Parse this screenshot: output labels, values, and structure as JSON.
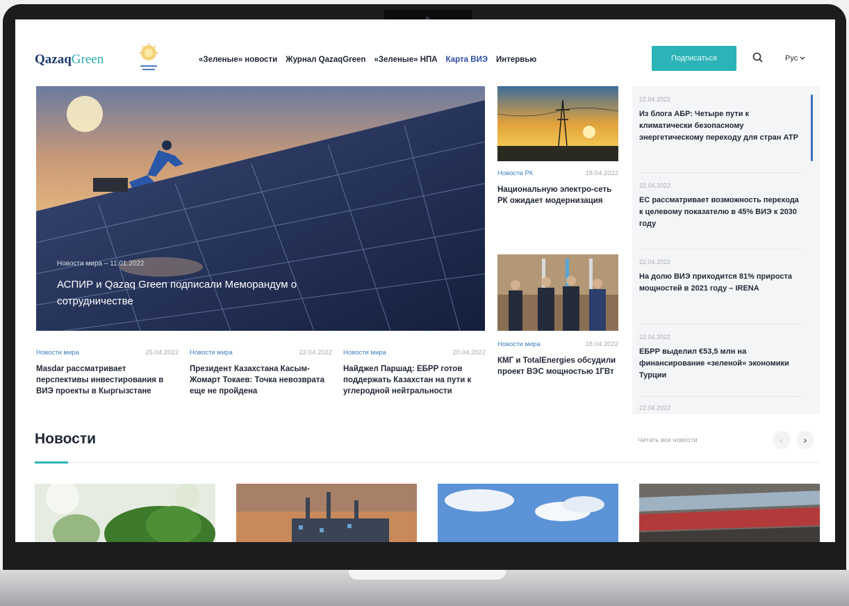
{
  "brand": {
    "logo_main": "Qazaq",
    "logo_accent": "Green",
    "accent_color": "#2bb3b7",
    "nav_active_color": "#2d4da3"
  },
  "nav": {
    "items": [
      "«Зеленые» новости",
      "Журнал QazaqGreen",
      "«Зеленые» НПА",
      "Карта ВИЭ",
      "Интервью"
    ],
    "subscribe_label": "Подписаться",
    "language": "Рус"
  },
  "hero": {
    "meta": "Новости мира – 11.01.2022",
    "title": "АСПИР и Qazaq Green подписали Меморандум о сотрудничестве"
  },
  "hero_news": [
    {
      "category": "Новости мира",
      "date": "25.04.2022",
      "title": "Masdar рассматривает перспективы инвестирования в ВИЭ проекты в Кыргызстане"
    },
    {
      "category": "Новости мира",
      "date": "22.04.2022",
      "title": "Президент Казахстана Касым-Жомарт Токаев: Точка невозврата еще не пройдена"
    },
    {
      "category": "Новости мира",
      "date": "20.04.2022",
      "title": "Найджел Паршад: ЕБРР готов поддержать Казахстан на пути к углеродной нейтральности"
    }
  ],
  "side_news": [
    {
      "category": "Новости РК",
      "date": "18.04.2022",
      "title": "Национальную электро-сеть РК ожидает модернизация"
    },
    {
      "category": "Новости мира",
      "date": "18.04.2022",
      "title": "КМГ и TotalEnergies обсудили проект ВЭС мощностью 1ГВт"
    }
  ],
  "right_news": [
    {
      "date": "22.04.2022",
      "title": "Из блога АБР: Четыре пути к климатически безопасному энергетическому переходу для стран АТР"
    },
    {
      "date": "22.04.2022",
      "title": "ЕС рассматривает возможность перехода к целевому показателю в 45% ВИЭ к 2030 году"
    },
    {
      "date": "22.04.2022",
      "title": "На долю ВИЭ приходится 81% прироста мощностей в 2021 году – IRENA"
    },
    {
      "date": "22.04.2022",
      "title": "ЕБРР выделил €53,5 млн на финансирование «зеленой» экономики Турции"
    },
    {
      "date": "22.04.2022",
      "title": ""
    }
  ],
  "news_section": {
    "title": "Новости",
    "read_all": "Читать все новости"
  }
}
